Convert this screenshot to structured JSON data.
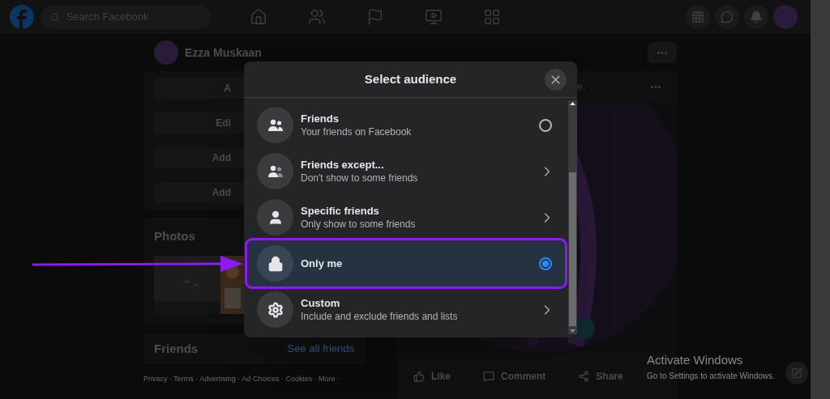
{
  "topbar": {
    "search": {
      "placeholder": "Search Facebook"
    }
  },
  "profile": {
    "name": "Ezza Muskaan",
    "buttons": [
      "A",
      "Edi",
      "Add",
      "Add"
    ]
  },
  "photos": {
    "title": "Photos"
  },
  "friends": {
    "title": "Friends",
    "link": "See all friends"
  },
  "footer": "Privacy · Terms · Advertising · Ad Choices · Cookies · More ·",
  "post": {
    "fragment": "e.",
    "actions": [
      "Like",
      "Comment",
      "Share"
    ]
  },
  "dialog": {
    "title": "Select audience",
    "options": [
      {
        "kind": "radio",
        "title": "Friends",
        "subtitle": "Your friends on Facebook",
        "selected": false,
        "highlighted": false
      },
      {
        "kind": "submenu",
        "title": "Friends except...",
        "subtitle": "Don't show to some friends",
        "selected": false,
        "highlighted": false
      },
      {
        "kind": "submenu",
        "title": "Specific friends",
        "subtitle": "Only show to some friends",
        "selected": false,
        "highlighted": false
      },
      {
        "kind": "radio",
        "title": "Only me",
        "selected": true,
        "highlighted": true
      },
      {
        "kind": "submenu",
        "title": "Custom",
        "subtitle": "Include and exclude friends and lists",
        "selected": false,
        "highlighted": false
      }
    ]
  },
  "windows_notice": {
    "title": "Activate Windows",
    "text": "Go to Settings to activate Windows."
  }
}
